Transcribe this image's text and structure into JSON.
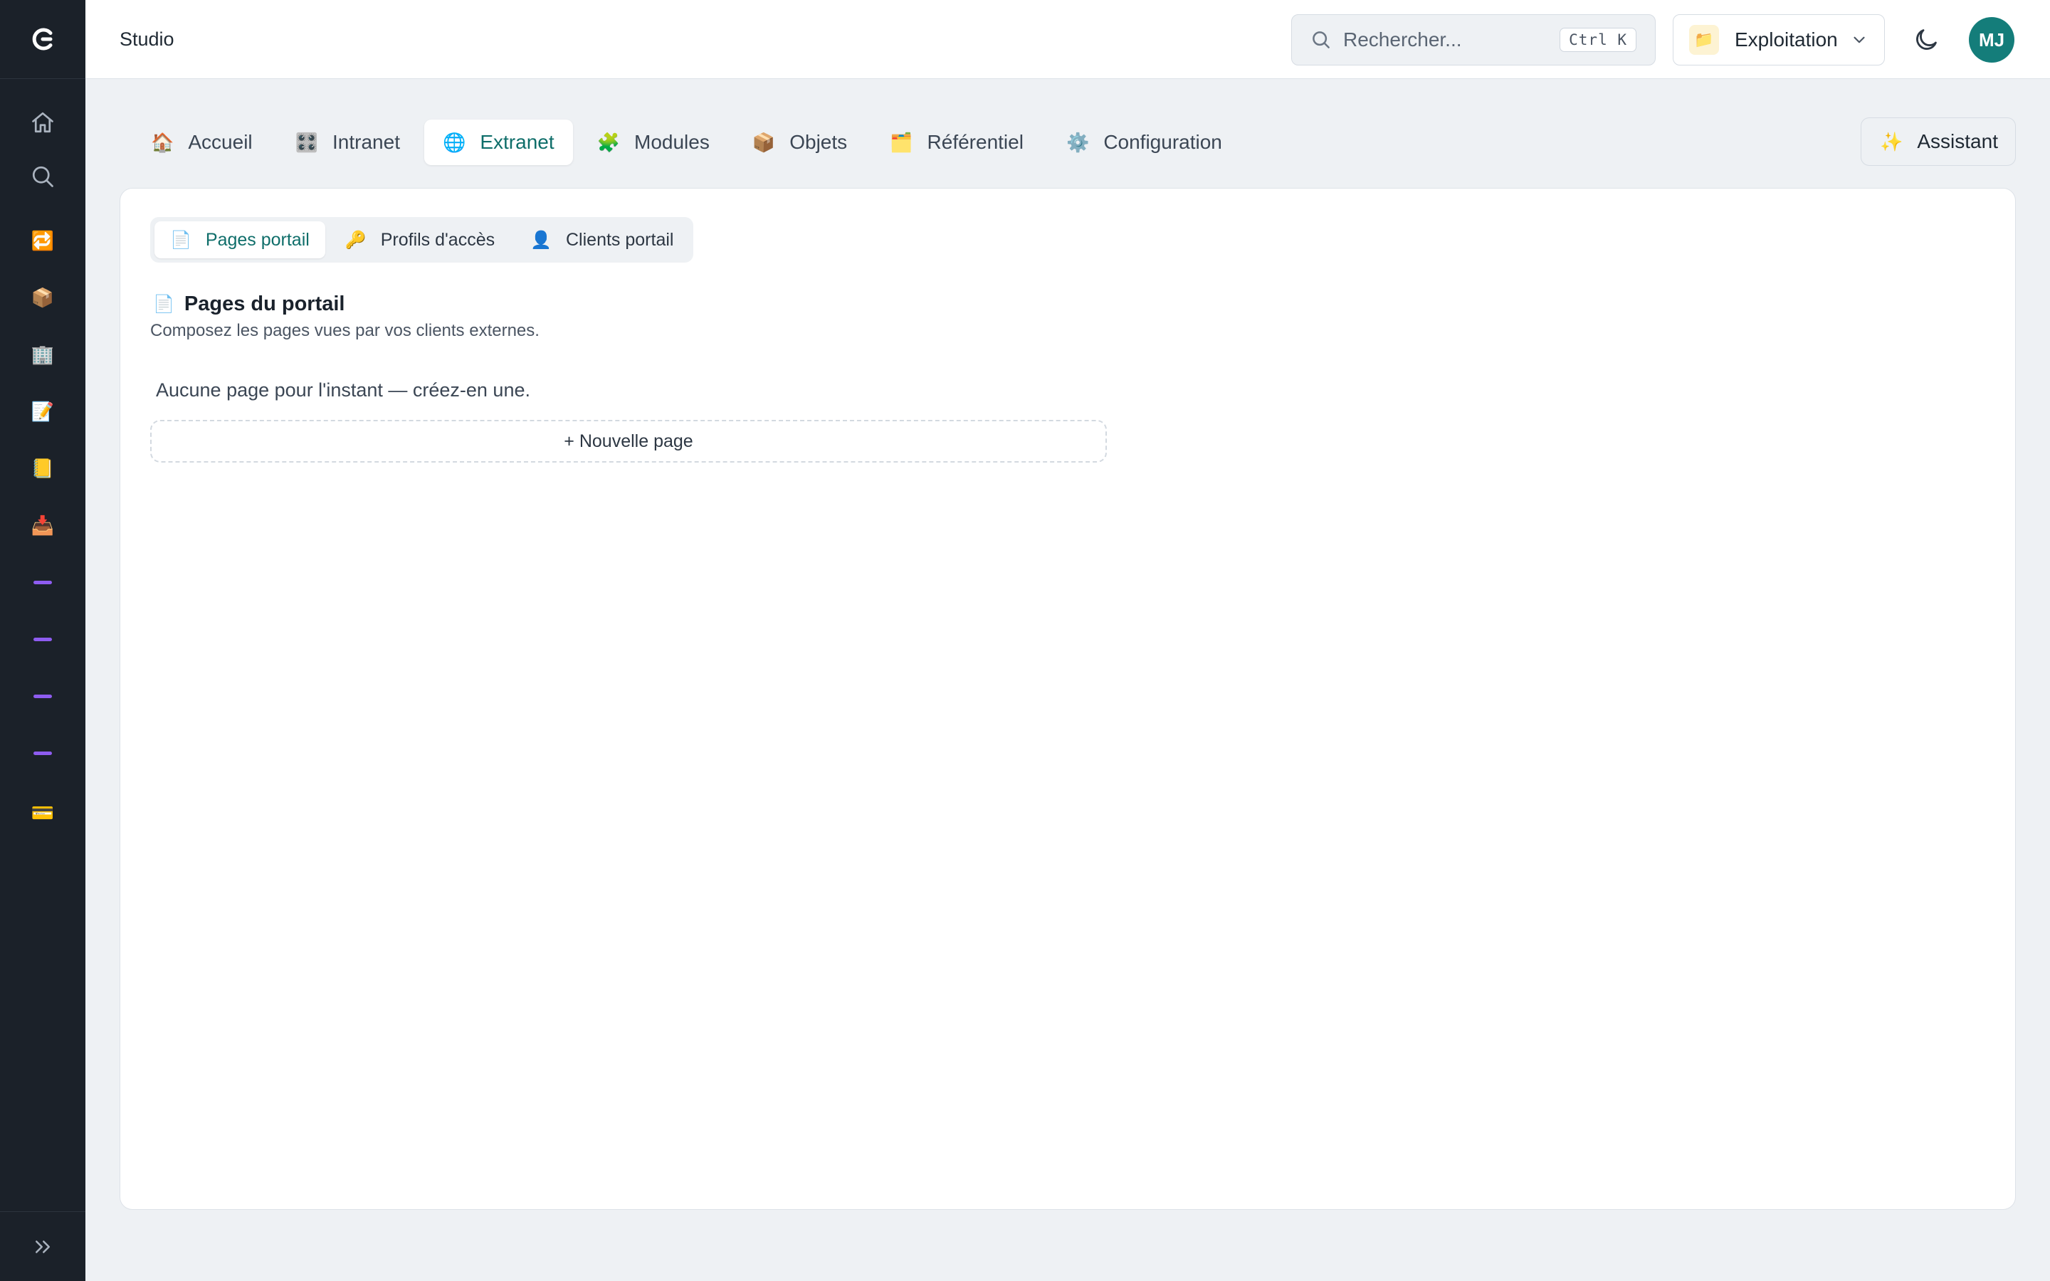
{
  "rail": {
    "logo": "G",
    "items": [
      {
        "name": "home",
        "icon": "home-icon"
      },
      {
        "name": "search",
        "icon": "search-icon"
      },
      {
        "name": "returns",
        "emoji": "🔁"
      },
      {
        "name": "package",
        "emoji": "📦"
      },
      {
        "name": "building",
        "emoji": "🏢"
      },
      {
        "name": "document-edit",
        "emoji": "📝"
      },
      {
        "name": "ledger",
        "emoji": "📒"
      },
      {
        "name": "inbox",
        "emoji": "📥"
      },
      {
        "name": "dash-1"
      },
      {
        "name": "dash-2"
      },
      {
        "name": "dash-3"
      },
      {
        "name": "dash-4"
      },
      {
        "name": "card",
        "emoji": "💳"
      }
    ],
    "expand_icon": "double-chevron-right-icon",
    "dash_color": "#8e5cf0"
  },
  "header": {
    "title": "Studio",
    "search": {
      "placeholder": "Rechercher...",
      "shortcut": "Ctrl K"
    },
    "workspace": {
      "icon": "📁",
      "label": "Exploitation"
    },
    "avatar_initials": "MJ",
    "avatar_color": "#147d7a"
  },
  "tabs": [
    {
      "icon": "🏠",
      "label": "Accueil",
      "active": false
    },
    {
      "icon": "🎛️",
      "label": "Intranet",
      "active": false
    },
    {
      "icon": "🌐",
      "label": "Extranet",
      "active": true
    },
    {
      "icon": "🧩",
      "label": "Modules",
      "active": false
    },
    {
      "icon": "📦",
      "label": "Objets",
      "active": false
    },
    {
      "icon": "🗂️",
      "label": "Référentiel",
      "active": false
    },
    {
      "icon": "⚙️",
      "label": "Configuration",
      "active": false
    }
  ],
  "assistant": {
    "icon": "✨",
    "label": "Assistant"
  },
  "subtabs": [
    {
      "icon": "📄",
      "label": "Pages portail",
      "active": true
    },
    {
      "icon": "🔑",
      "label": "Profils d'accès",
      "active": false
    },
    {
      "icon": "👤",
      "label": "Clients portail",
      "active": false
    }
  ],
  "section": {
    "icon": "📄",
    "title": "Pages du portail",
    "description": "Composez les pages vues par vos clients externes.",
    "empty_text": "Aucune page pour l'instant — créez-en une.",
    "new_button": "+ Nouvelle page"
  },
  "accent_color": "#0f6e6a"
}
